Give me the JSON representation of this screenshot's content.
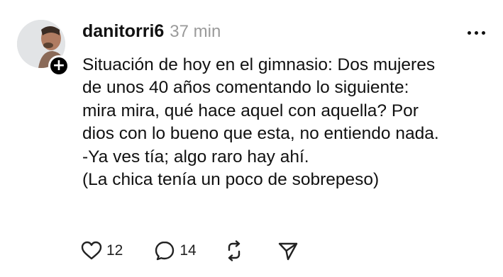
{
  "post": {
    "username": "danitorri6",
    "timestamp": "37 min",
    "body_lines": [
      "Situación de hoy en el gimnasio: Dos mujeres",
      "de unos 40 años comentando lo siguiente:",
      "mira mira, qué hace aquel con aquella? Por",
      "dios con lo bueno que esta, no entiendo nada.",
      "-Ya ves tía; algo raro hay ahí.",
      "(La chica tenía un poco de sobrepeso)"
    ],
    "likes": "12",
    "replies": "14"
  },
  "icons": {
    "follow": "plus-icon",
    "more": "more-horizontal-icon",
    "like": "heart-icon",
    "reply": "comment-icon",
    "repost": "repost-icon",
    "share": "send-icon"
  },
  "colors": {
    "text": "#111111",
    "muted": "#9a9a9a",
    "background": "#ffffff"
  }
}
